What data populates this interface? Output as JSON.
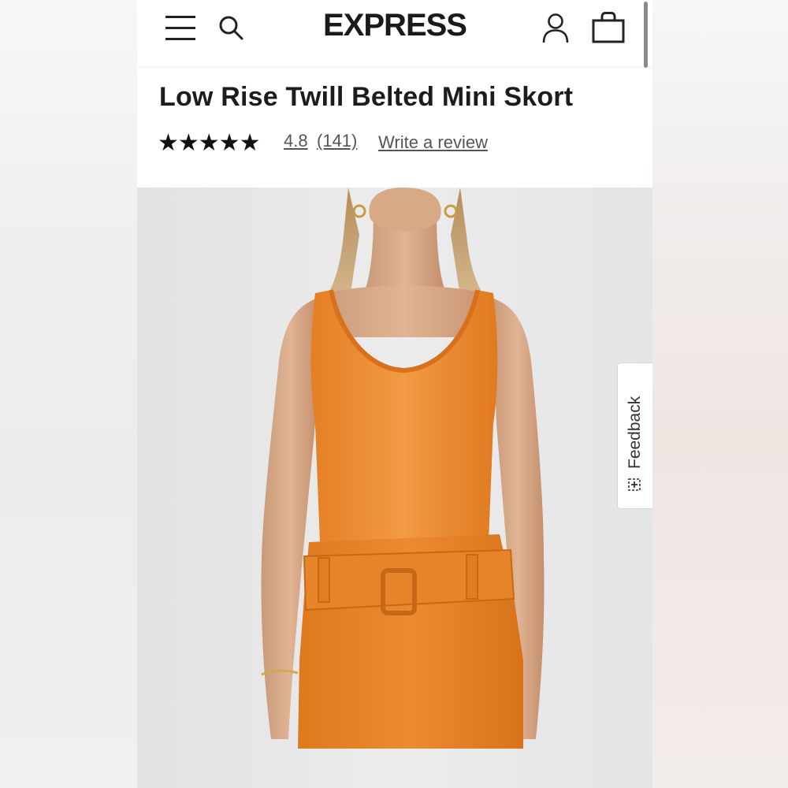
{
  "header": {
    "brand": "EXPRESS",
    "icons": [
      "menu-icon",
      "search-icon",
      "account-icon",
      "shopping-bag-icon"
    ]
  },
  "product": {
    "title": "Low Rise Twill Belted Mini Skort",
    "stars": "★★★★★",
    "rating": 4.8,
    "rating_display": "4.8",
    "review_count_display": "(141)",
    "write_review_label": "Write a review",
    "image_colors": {
      "outfit": "#e98a2e",
      "background": "#e7e7e9"
    }
  },
  "feedback": {
    "label": "Feedback",
    "icon": "feedback-plus-icon"
  },
  "colors": {
    "text": "#1c1c1c",
    "link": "#555555",
    "header_bg": "#ffffff"
  }
}
